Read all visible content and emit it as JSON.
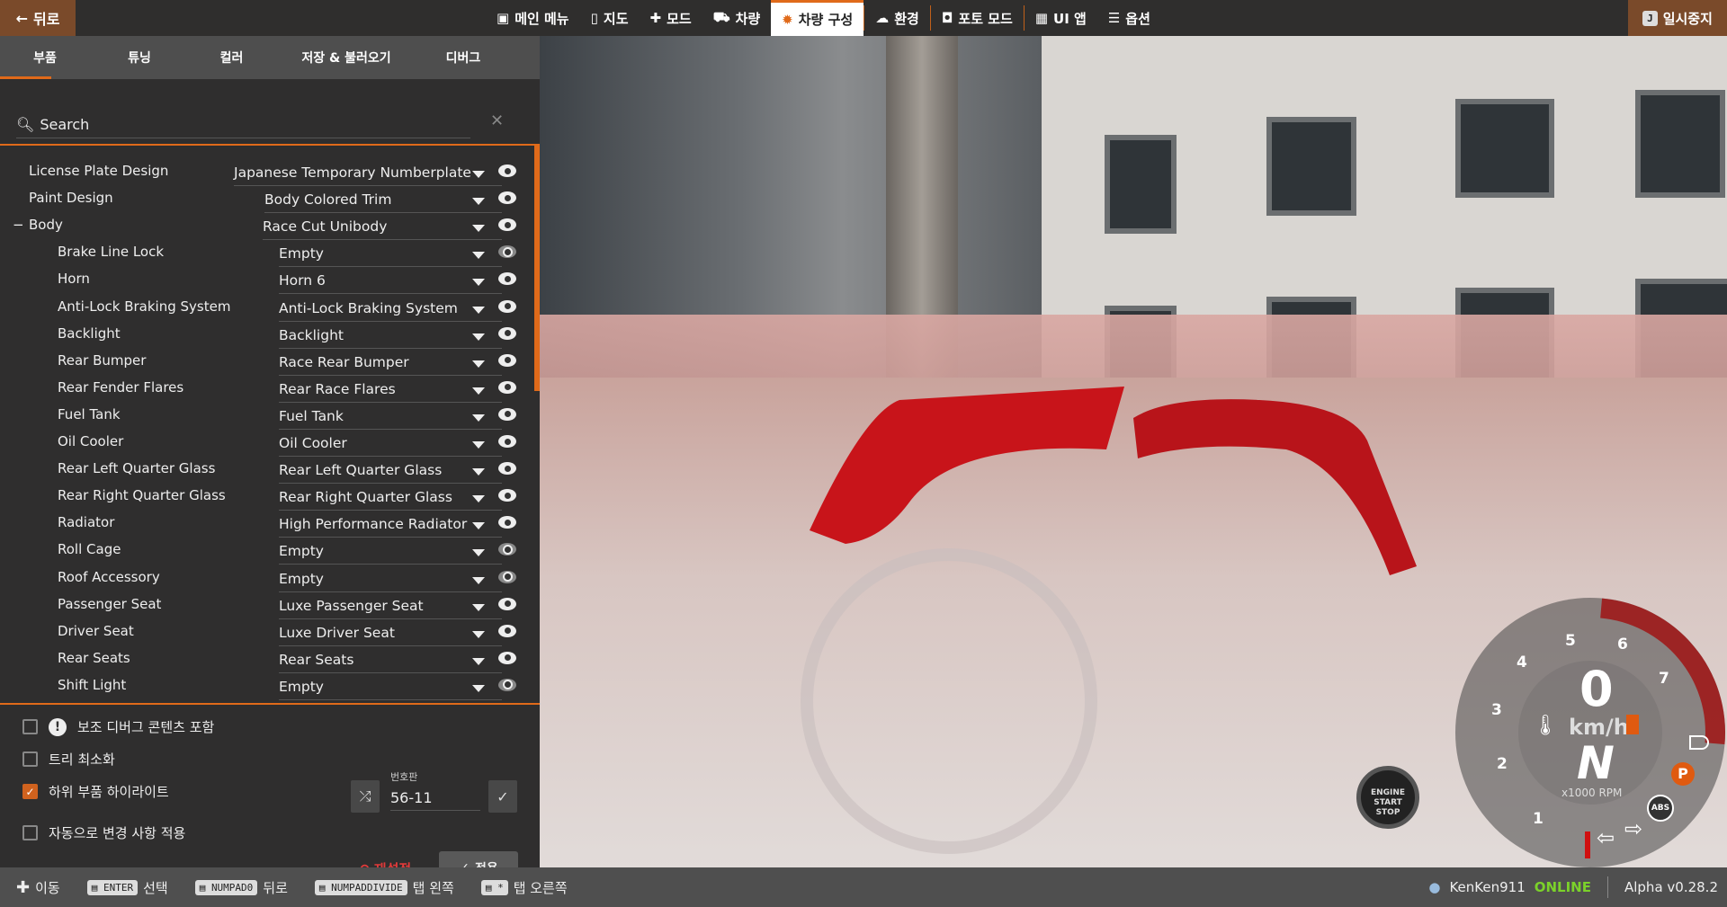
{
  "topbar": {
    "back_label": "뒤로",
    "nav": [
      {
        "icon": "main-menu-icon",
        "label": "메인 메뉴"
      },
      {
        "icon": "map-icon",
        "label": "지도"
      },
      {
        "icon": "puzzle-icon",
        "label": "모드"
      },
      {
        "icon": "car-icon",
        "label": "차량"
      },
      {
        "icon": "engine-icon",
        "label": "차량 구성",
        "active": true
      },
      {
        "icon": "weather-icon",
        "label": "환경"
      },
      {
        "icon": "camera-icon",
        "label": "포토 모드"
      },
      {
        "icon": "ui-apps-icon",
        "label": "UI 앱"
      },
      {
        "icon": "sliders-icon",
        "label": "옵션"
      }
    ],
    "pause_key": "J",
    "pause_label": "일시중지"
  },
  "panel": {
    "tabs": [
      "부품",
      "튜닝",
      "컬러",
      "저장 & 불러오기",
      "디버그"
    ],
    "active_tab": "부품",
    "search_placeholder": "Search",
    "rows": [
      {
        "label": "License Plate Design",
        "value": "Japanese Temporary Numberplate",
        "level": 0
      },
      {
        "label": "Paint Design",
        "value": "Body Colored Trim",
        "level": 0
      },
      {
        "label": "Body",
        "value": "Race Cut Unibody",
        "level": 0,
        "expanded": true
      },
      {
        "label": "Brake Line Lock",
        "value": "Empty",
        "level": 1,
        "dim": true
      },
      {
        "label": "Horn",
        "value": "Horn 6",
        "level": 1
      },
      {
        "label": "Anti-Lock Braking System",
        "value": "Anti-Lock Braking System",
        "level": 1
      },
      {
        "label": "Backlight",
        "value": "Backlight",
        "level": 1
      },
      {
        "label": "Rear Bumper",
        "value": "Race Rear Bumper",
        "level": 1
      },
      {
        "label": "Rear Fender Flares",
        "value": "Rear Race Flares",
        "level": 1
      },
      {
        "label": "Fuel Tank",
        "value": "Fuel Tank",
        "level": 1
      },
      {
        "label": "Oil Cooler",
        "value": "Oil Cooler",
        "level": 1
      },
      {
        "label": "Rear Left Quarter Glass",
        "value": "Rear Left Quarter Glass",
        "level": 1
      },
      {
        "label": "Rear Right Quarter Glass",
        "value": "Rear Right Quarter Glass",
        "level": 1
      },
      {
        "label": "Radiator",
        "value": "High Performance Radiator",
        "level": 1
      },
      {
        "label": "Roll Cage",
        "value": "Empty",
        "level": 1,
        "dim": true
      },
      {
        "label": "Roof Accessory",
        "value": "Empty",
        "level": 1,
        "dim": true
      },
      {
        "label": "Passenger Seat",
        "value": "Luxe Passenger Seat",
        "level": 1
      },
      {
        "label": "Driver Seat",
        "value": "Luxe Driver Seat",
        "level": 1
      },
      {
        "label": "Rear Seats",
        "value": "Rear Seats",
        "level": 1
      },
      {
        "label": "Shift Light",
        "value": "Empty",
        "level": 1,
        "dim": true
      }
    ],
    "options": {
      "aux_debug": {
        "label": "보조 디버그 콘텐츠 포함",
        "checked": false
      },
      "minimize_tree": {
        "label": "트리 최소화",
        "checked": false
      },
      "highlight_sub": {
        "label": "하위 부품 하이라이트",
        "checked": true
      },
      "auto_apply": {
        "label": "자동으로 변경 사항 적용",
        "checked": false
      }
    },
    "plate_label": "번호판",
    "plate_value": "56-11",
    "reset_label": "재설정",
    "apply_label": "적용"
  },
  "bottombar": {
    "hints": [
      {
        "key": "",
        "label": "이동"
      },
      {
        "key": "ENTER",
        "label": "선택"
      },
      {
        "key": "NUMPAD0",
        "label": "뒤로"
      },
      {
        "key": "NUMPADDIVIDE",
        "label": "탭 왼쪽"
      },
      {
        "key": "*",
        "label": "탭 오른쪽"
      }
    ],
    "user": "KenKen911",
    "status": "ONLINE",
    "version": "Alpha v0.28.2"
  },
  "hud": {
    "speed": "0",
    "unit": "km/h",
    "gear": "N",
    "rpm_label": "x1000 RPM",
    "rpm_ticks": [
      "1",
      "2",
      "3",
      "4",
      "5",
      "6",
      "7"
    ],
    "engine_button": [
      "ENGINE",
      "START",
      "STOP"
    ],
    "park_label": "P",
    "abs_label": "ABS",
    "colors": {
      "accent": "#e06a1a",
      "online": "#7bd12a",
      "reset": "#e23a3a"
    }
  }
}
